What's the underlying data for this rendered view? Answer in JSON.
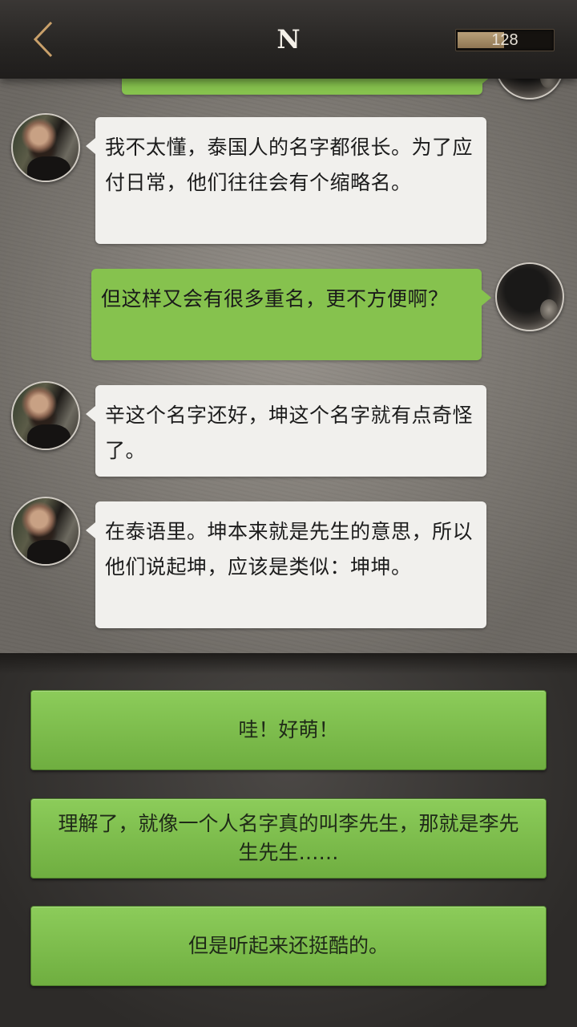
{
  "header": {
    "title": "N",
    "coins": "128",
    "back_icon": "chevron-left-icon"
  },
  "colors": {
    "header_bg": "#272523",
    "chat_bg": "#8f8a83",
    "bubble_left": "#f1f0ed",
    "bubble_right": "#86c24e",
    "option_green": "#7bbd4b",
    "back_accent": "#c9a06a"
  },
  "messages": [
    {
      "side": "right",
      "text": "",
      "avatar": "dark-avatar"
    },
    {
      "side": "left",
      "text": "我不太懂，泰国人的名字都很长。为了应付日常，他们往往会有个缩略名。",
      "avatar": "man-avatar"
    },
    {
      "side": "right",
      "text": "但这样又会有很多重名，更不方便啊？",
      "avatar": "dark-avatar"
    },
    {
      "side": "left",
      "text": "辛这个名字还好，坤这个名字就有点奇怪了。",
      "avatar": "man-avatar"
    },
    {
      "side": "left",
      "text": "在泰语里。坤本来就是先生的意思，所以他们说起坤，应该是类似：坤坤。",
      "avatar": "man-avatar"
    }
  ],
  "options": [
    {
      "label": "哇！好萌！"
    },
    {
      "label": "理解了，就像一个人名字真的叫李先生，那就是李先生先生……"
    },
    {
      "label": "但是听起来还挺酷的。"
    }
  ]
}
